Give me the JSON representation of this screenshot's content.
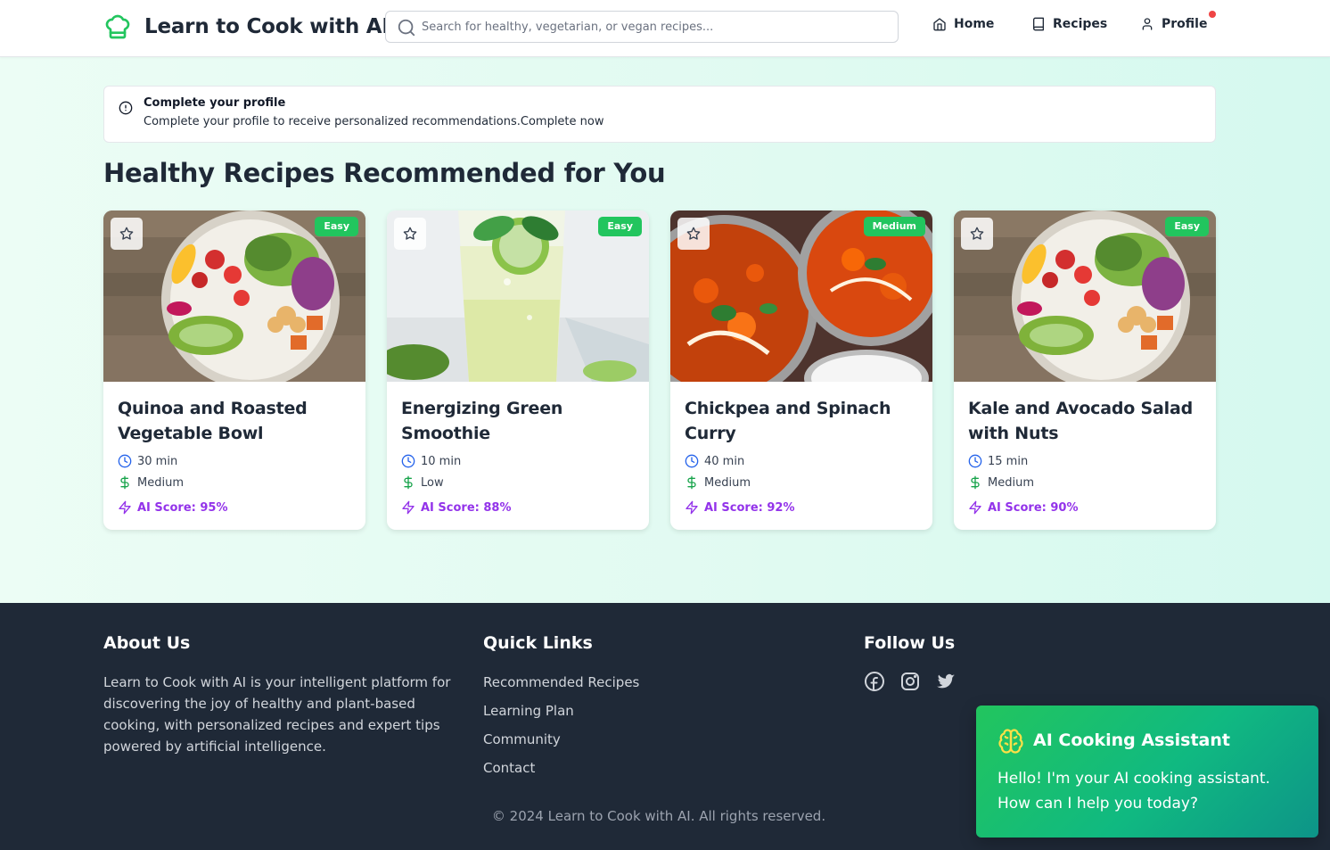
{
  "header": {
    "brand_title": "Learn to Cook with AI",
    "brand_icon": "chef-hat-icon",
    "search_placeholder": "Search for healthy, vegetarian, or vegan recipes...",
    "nav": [
      {
        "label": "Home",
        "icon": "home-icon"
      },
      {
        "label": "Recipes",
        "icon": "book-icon"
      },
      {
        "label": "Profile",
        "icon": "user-icon"
      }
    ],
    "notification_color": "#ef4444"
  },
  "alert": {
    "title": "Complete your profile",
    "description": "Complete your profile to receive personalized recommendations.Complete now"
  },
  "section_title": "Healthy Recipes Recommended for You",
  "recipes": [
    {
      "title": "Quinoa and Roasted Vegetable Bowl",
      "difficulty": "Easy",
      "time": "30 min",
      "cost": "Medium",
      "ai_score": "AI Score: 95%",
      "image": "salad-bowl"
    },
    {
      "title": "Energizing Green Smoothie",
      "difficulty": "Easy",
      "time": "10 min",
      "cost": "Low",
      "ai_score": "AI Score: 88%",
      "image": "green-drink"
    },
    {
      "title": "Chickpea and Spinach Curry",
      "difficulty": "Medium",
      "time": "40 min",
      "cost": "Medium",
      "ai_score": "AI Score: 92%",
      "image": "curry-bowls"
    },
    {
      "title": "Kale and Avocado Salad with Nuts",
      "difficulty": "Easy",
      "time": "15 min",
      "cost": "Medium",
      "ai_score": "AI Score: 90%",
      "image": "salad-bowl"
    }
  ],
  "footer": {
    "about_title": "About Us",
    "about_text": "Learn to Cook with AI is your intelligent platform for discovering the joy of healthy and plant-based cooking, with personalized recipes and expert tips powered by artificial intelligence.",
    "links_title": "Quick Links",
    "links": [
      "Recommended Recipes",
      "Learning Plan",
      "Community",
      "Contact"
    ],
    "follow_title": "Follow Us",
    "social": [
      "facebook-icon",
      "instagram-icon",
      "twitter-icon"
    ],
    "copyright": "© 2024 Learn to Cook with AI. All rights reserved."
  },
  "assistant": {
    "title": "AI Cooking Assistant",
    "message": "Hello! I'm your AI cooking assistant. How can I help you today?",
    "icon": "brain-icon"
  },
  "colors": {
    "brand_green": "#22c55e",
    "score_purple": "#9333ea",
    "clock_blue": "#2563eb",
    "cost_green": "#16a34a",
    "footer_bg": "#1f2937"
  }
}
